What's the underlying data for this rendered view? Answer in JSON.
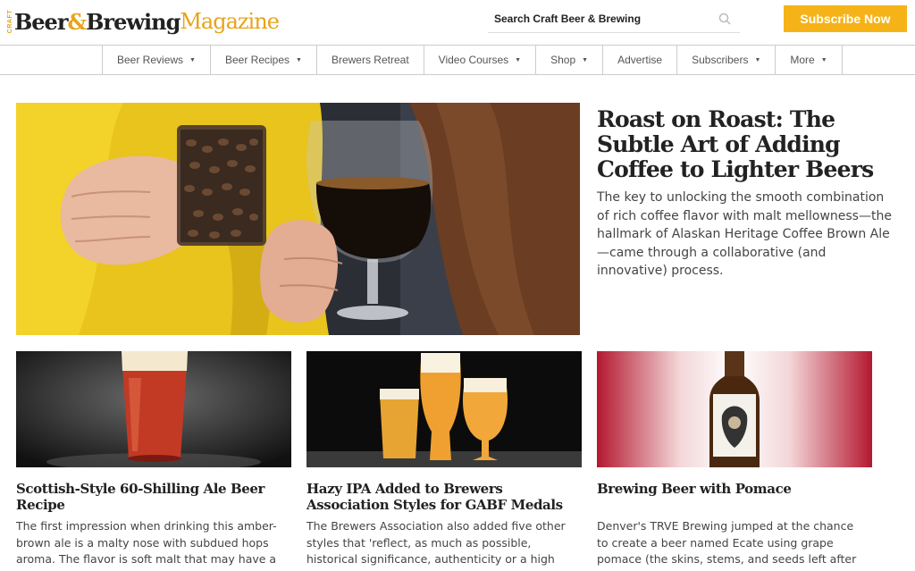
{
  "header": {
    "logo": {
      "craft": "CRAFT",
      "beer": "Beer",
      "amp": "&",
      "brewing": "Brewing",
      "magazine": "Magazine"
    },
    "search": {
      "placeholder": "Search Craft Beer & Brewing",
      "icon": "search-icon"
    },
    "subscribe_label": "Subscribe Now",
    "accent_color": "#f6b318"
  },
  "nav": {
    "items": [
      {
        "label": "Beer Reviews",
        "caret": "▼"
      },
      {
        "label": "Beer Recipes",
        "caret": "▼"
      },
      {
        "label": "Brewers Retreat",
        "caret": ""
      },
      {
        "label": "Video Courses",
        "caret": "▼"
      },
      {
        "label": "Shop",
        "caret": "▼"
      },
      {
        "label": "Advertise",
        "caret": ""
      },
      {
        "label": "Subscribers",
        "caret": "▼"
      },
      {
        "label": "More",
        "caret": "▼"
      }
    ]
  },
  "hero": {
    "title": "Roast on Roast: The Subtle Art of Adding Coffee to Lighter Beers",
    "description": "The key to unlocking the smooth combination of rich coffee flavor with malt mellowness—the hallmark of Alaskan Heritage Coffee Brown Ale—came through a collaborative (and innovative) process."
  },
  "cards": [
    {
      "title": "Scottish-Style 60-Shilling Ale Beer Recipe",
      "description": "The first impression when drinking this amber-brown ale is a malty nose with subdued hops aroma. The flavor is soft malt that may have a"
    },
    {
      "title": "Hazy IPA Added to Brewers Association Styles for GABF Medals",
      "description": "The Brewers Association also added five other styles that 'reflect, as much as possible, historical significance, authenticity or a high"
    },
    {
      "title": "Brewing Beer with Pomace",
      "description": "Denver's TRVE Brewing jumped at the chance to create a beer named Ecate using grape pomace (the skins, stems, and seeds left after juice is pressed) that a local winery was discarding."
    }
  ]
}
